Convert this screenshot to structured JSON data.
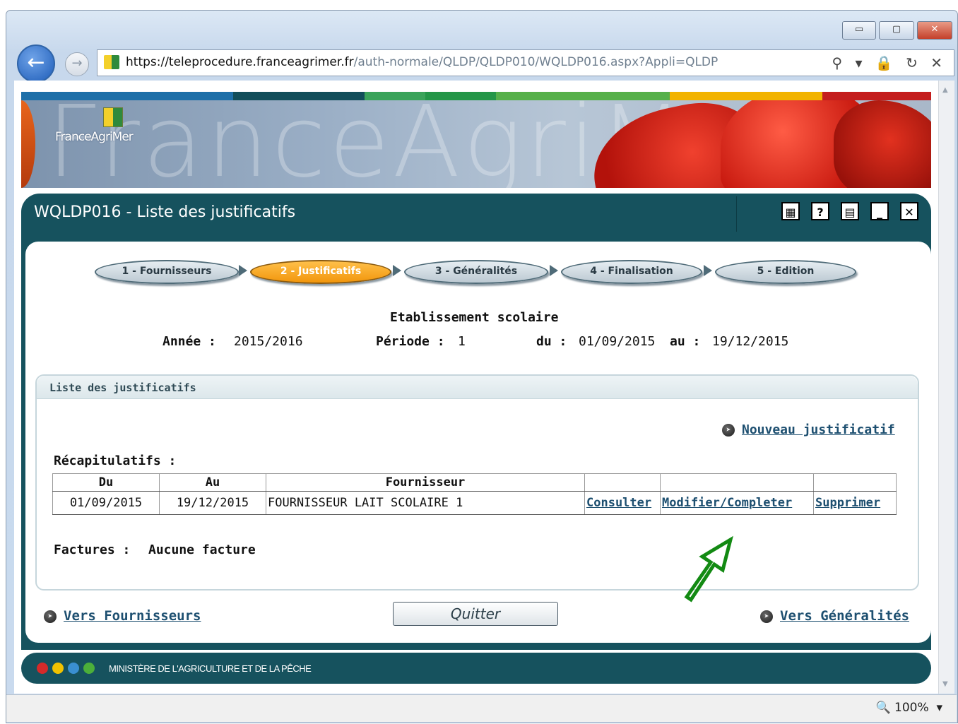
{
  "browser": {
    "url_domain": "https://teleprocedure.franceagrimer.fr",
    "url_path": "/auth-normale/QLDP/QLDP010/WQLDP016.aspx?Appli=QLDP",
    "address_icons": "⚲ ▾ 🔒 ↻ ✕",
    "window_controls": [
      "▭",
      "▢",
      "✕"
    ],
    "zoom": "100%"
  },
  "site": {
    "logo_text": "FranceAgriMer",
    "banner_watermark": "FranceAgriMer",
    "strip_colors": [
      "#1e6fa8",
      "#124e5a",
      "#3aa35a",
      "#249648",
      "#56b04a",
      "#f2b300",
      "#c41d1d"
    ]
  },
  "header": {
    "title": "WQLDP016 - Liste des justificatifs",
    "icons": [
      "calculator-icon",
      "help-icon",
      "print-icon",
      "minimize-icon",
      "close-icon"
    ]
  },
  "wizard": {
    "steps": [
      "1 - Fournisseurs",
      "2 - Justificatifs",
      "3 - Généralités",
      "4 - Finalisation",
      "5 - Edition"
    ],
    "active_step": 2
  },
  "info": {
    "establishment": "Etablissement scolaire",
    "year_label": "Année :",
    "year_value": "2015/2016",
    "period_label": "Période :",
    "period_value": "1",
    "from_label": "du :",
    "from_value": "01/09/2015",
    "to_label": "au :",
    "to_value": "19/12/2015"
  },
  "list": {
    "title": "Liste des justificatifs",
    "new_link": "Nouveau justificatif",
    "recap_label": "Récapitulatifs :",
    "columns": [
      "Du",
      "Au",
      "Fournisseur",
      "",
      "",
      ""
    ],
    "rows": [
      {
        "du": "01/09/2015",
        "au": "19/12/2015",
        "fournisseur": "FOURNISSEUR LAIT SCOLAIRE 1",
        "consult": "Consulter",
        "modify": "Modifier/Completer",
        "delete": "Supprimer"
      }
    ],
    "invoices_label": "Factures :",
    "invoices_value": "Aucune facture"
  },
  "nav": {
    "back_link": "Vers Fournisseurs",
    "quit_button": "Quitter",
    "next_link": "Vers Généralités"
  },
  "footer": {
    "text": "MINISTÈRE DE L'AGRICULTURE ET DE LA PÊCHE",
    "dot_colors": [
      "#d42a2a",
      "#f2c200",
      "#3a8fd0",
      "#4caf3a"
    ]
  },
  "annotation": {
    "arrow_color": "#138a13"
  }
}
